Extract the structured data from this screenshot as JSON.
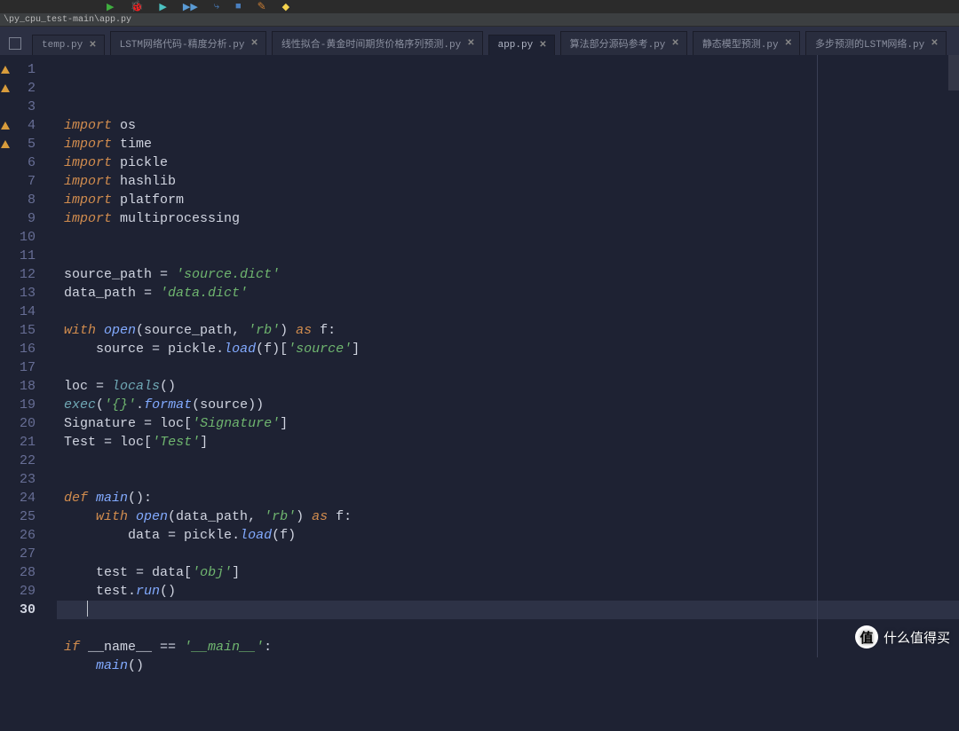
{
  "path_bar": "\\py_cpu_test-main\\app.py",
  "tabs": [
    {
      "label": "temp.py",
      "active": false
    },
    {
      "label": "LSTM网络代码-精度分析.py",
      "active": false
    },
    {
      "label": "线性拟合-黄金时间期货价格序列预测.py",
      "active": false
    },
    {
      "label": "app.py",
      "active": true
    },
    {
      "label": "算法部分源码参考.py",
      "active": false
    },
    {
      "label": "静态模型预测.py",
      "active": false
    },
    {
      "label": "多步预测的LSTM网络.py",
      "active": false
    }
  ],
  "gutter_warnings": [
    1,
    2,
    4,
    5
  ],
  "current_line": 30,
  "code_lines": [
    [
      [
        "kw",
        "import"
      ],
      [
        "id",
        " os"
      ]
    ],
    [
      [
        "kw",
        "import"
      ],
      [
        "id",
        " time"
      ]
    ],
    [
      [
        "kw",
        "import"
      ],
      [
        "id",
        " pickle"
      ]
    ],
    [
      [
        "kw",
        "import"
      ],
      [
        "id",
        " hashlib"
      ]
    ],
    [
      [
        "kw",
        "import"
      ],
      [
        "id",
        " platform"
      ]
    ],
    [
      [
        "kw",
        "import"
      ],
      [
        "id",
        " multiprocessing"
      ]
    ],
    [],
    [],
    [
      [
        "id",
        "source_path "
      ],
      [
        "op",
        "= "
      ],
      [
        "str",
        "'source.dict'"
      ]
    ],
    [
      [
        "id",
        "data_path "
      ],
      [
        "op",
        "= "
      ],
      [
        "str",
        "'data.dict'"
      ]
    ],
    [],
    [
      [
        "kw",
        "with "
      ],
      [
        "fn",
        "open"
      ],
      [
        "op",
        "("
      ],
      [
        "id",
        "source_path"
      ],
      [
        "op",
        ", "
      ],
      [
        "str",
        "'rb'"
      ],
      [
        "op",
        ") "
      ],
      [
        "kw",
        "as "
      ],
      [
        "id",
        "f"
      ],
      [
        "op",
        ":"
      ]
    ],
    [
      [
        "id",
        "    source "
      ],
      [
        "op",
        "= "
      ],
      [
        "id",
        "pickle"
      ],
      [
        "op",
        "."
      ],
      [
        "fn",
        "load"
      ],
      [
        "op",
        "("
      ],
      [
        "id",
        "f"
      ],
      [
        "op",
        ")["
      ],
      [
        "str",
        "'source'"
      ],
      [
        "op",
        "]"
      ]
    ],
    [],
    [
      [
        "id",
        "loc "
      ],
      [
        "op",
        "= "
      ],
      [
        "builtin",
        "locals"
      ],
      [
        "op",
        "()"
      ]
    ],
    [
      [
        "builtin",
        "exec"
      ],
      [
        "op",
        "("
      ],
      [
        "str",
        "'{}'"
      ],
      [
        "op",
        "."
      ],
      [
        "fn",
        "format"
      ],
      [
        "op",
        "("
      ],
      [
        "id",
        "source"
      ],
      [
        "op",
        "))"
      ]
    ],
    [
      [
        "id",
        "Signature "
      ],
      [
        "op",
        "= "
      ],
      [
        "id",
        "loc"
      ],
      [
        "op",
        "["
      ],
      [
        "str",
        "'Signature'"
      ],
      [
        "op",
        "]"
      ]
    ],
    [
      [
        "id",
        "Test "
      ],
      [
        "op",
        "= "
      ],
      [
        "id",
        "loc"
      ],
      [
        "op",
        "["
      ],
      [
        "str",
        "'Test'"
      ],
      [
        "op",
        "]"
      ]
    ],
    [],
    [],
    [
      [
        "kw",
        "def "
      ],
      [
        "fn",
        "main"
      ],
      [
        "op",
        "():"
      ]
    ],
    [
      [
        "kw",
        "    with "
      ],
      [
        "fn",
        "open"
      ],
      [
        "op",
        "("
      ],
      [
        "id",
        "data_path"
      ],
      [
        "op",
        ", "
      ],
      [
        "str",
        "'rb'"
      ],
      [
        "op",
        ") "
      ],
      [
        "kw",
        "as "
      ],
      [
        "id",
        "f"
      ],
      [
        "op",
        ":"
      ]
    ],
    [
      [
        "id",
        "        data "
      ],
      [
        "op",
        "= "
      ],
      [
        "id",
        "pickle"
      ],
      [
        "op",
        "."
      ],
      [
        "fn",
        "load"
      ],
      [
        "op",
        "("
      ],
      [
        "id",
        "f"
      ],
      [
        "op",
        ")"
      ]
    ],
    [],
    [
      [
        "id",
        "    test "
      ],
      [
        "op",
        "= "
      ],
      [
        "id",
        "data"
      ],
      [
        "op",
        "["
      ],
      [
        "str",
        "'obj'"
      ],
      [
        "op",
        "]"
      ]
    ],
    [
      [
        "id",
        "    test"
      ],
      [
        "op",
        "."
      ],
      [
        "fn",
        "run"
      ],
      [
        "op",
        "()"
      ]
    ],
    [],
    [],
    [
      [
        "kw",
        "if "
      ],
      [
        "id",
        "__name__"
      ],
      [
        "op",
        " == "
      ],
      [
        "str",
        "'__main__'"
      ],
      [
        "op",
        ":"
      ]
    ],
    [
      [
        "id",
        "    "
      ],
      [
        "fn",
        "main"
      ],
      [
        "op",
        "()"
      ]
    ]
  ],
  "watermark": {
    "badge": "值",
    "text": "什么值得买"
  }
}
